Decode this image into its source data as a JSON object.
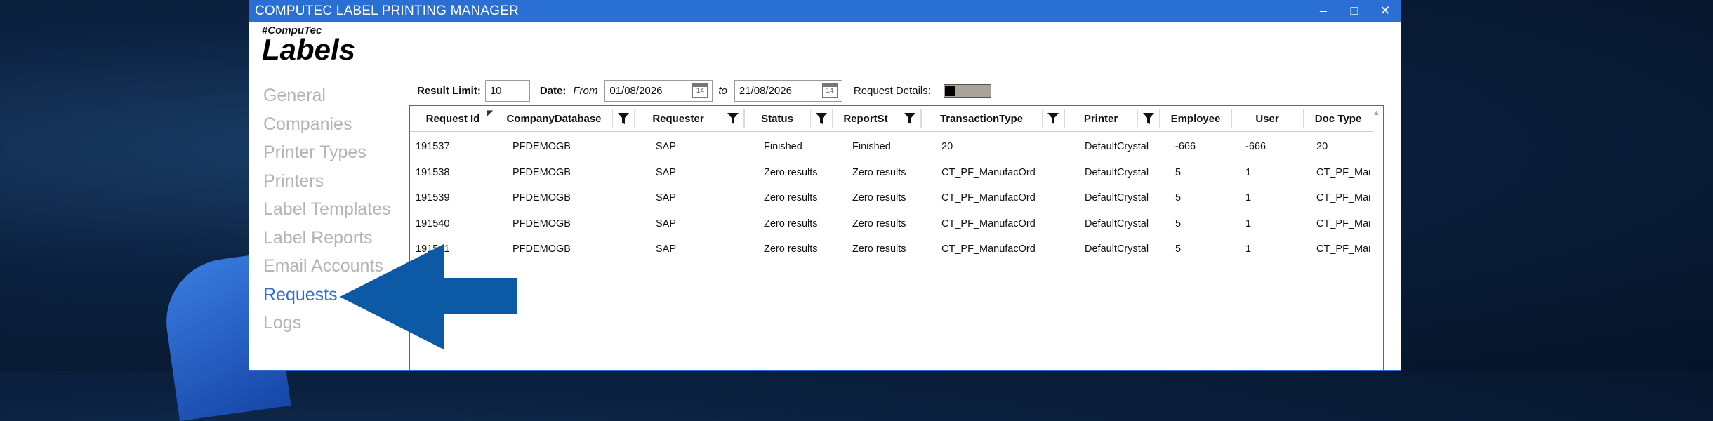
{
  "window": {
    "title": "COMPUTEC LABEL PRINTING MANAGER",
    "controls": {
      "minimize": "–",
      "maximize": "□",
      "close": "✕"
    }
  },
  "brand": {
    "tagline": "#CompuTec",
    "name": "Labels"
  },
  "sidebar": {
    "items": [
      {
        "label": "General"
      },
      {
        "label": "Companies"
      },
      {
        "label": "Printer Types"
      },
      {
        "label": "Printers"
      },
      {
        "label": "Label Templates"
      },
      {
        "label": "Label Reports"
      },
      {
        "label": "Email Accounts"
      },
      {
        "label": "Requests",
        "active": true
      },
      {
        "label": "Logs"
      }
    ]
  },
  "filters": {
    "result_limit_label": "Result Limit:",
    "result_limit_value": "10",
    "date_label": "Date:",
    "from_label": "From",
    "from_value": "01/08/2026",
    "to_label": "to",
    "to_value": "21/08/2026",
    "calendar_glyph": "14",
    "request_details_label": "Request Details:",
    "request_details_on": false
  },
  "table": {
    "columns": [
      "Request Id",
      "CompanyDatabase",
      "Requester",
      "Status",
      "ReportSt",
      "TransactionType",
      "Printer",
      "Employee",
      "User",
      "Doc Type"
    ],
    "rows": [
      [
        "191537",
        "PFDEMOGB",
        "SAP",
        "Finished",
        "Finished",
        "20",
        "DefaultCrystal",
        "-666",
        "-666",
        "20"
      ],
      [
        "191538",
        "PFDEMOGB",
        "SAP",
        "Zero results",
        "Zero results",
        "CT_PF_ManufacOrd",
        "DefaultCrystal",
        "5",
        "1",
        "CT_PF_Man"
      ],
      [
        "191539",
        "PFDEMOGB",
        "SAP",
        "Zero results",
        "Zero results",
        "CT_PF_ManufacOrd",
        "DefaultCrystal",
        "5",
        "1",
        "CT_PF_Man"
      ],
      [
        "191540",
        "PFDEMOGB",
        "SAP",
        "Zero results",
        "Zero results",
        "CT_PF_ManufacOrd",
        "DefaultCrystal",
        "5",
        "1",
        "CT_PF_Man"
      ],
      [
        "191541",
        "PFDEMOGB",
        "SAP",
        "Zero results",
        "Zero results",
        "CT_PF_ManufacOrd",
        "DefaultCrystal",
        "5",
        "1",
        "CT_PF_Man"
      ]
    ]
  },
  "colors": {
    "accent": "#2a6fd4",
    "pointer_arrow": "#0c5aa6",
    "nav_inactive": "#b4b4b4",
    "nav_active": "#2f6fd8"
  }
}
